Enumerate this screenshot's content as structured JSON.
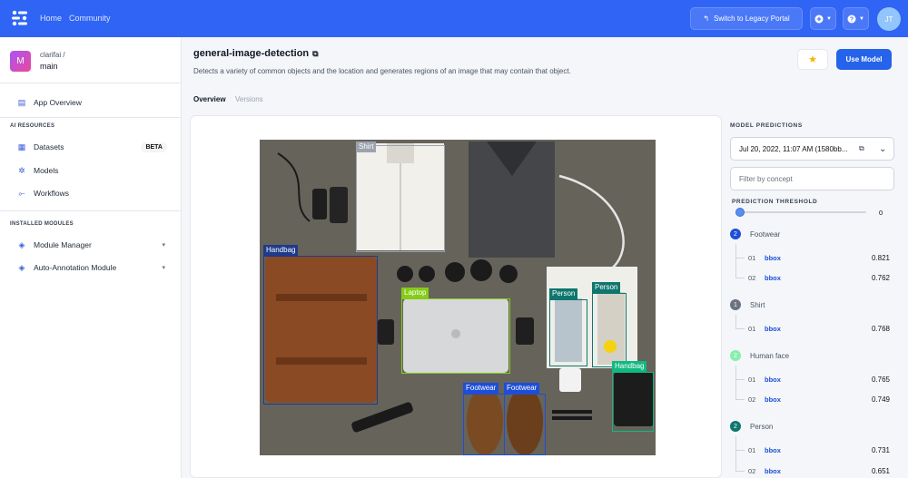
{
  "nav": {
    "links": [
      "Home",
      "Community"
    ],
    "legacy_button": "Switch to Legacy Portal",
    "user_initials": "JT",
    "add_icon": "plus-circle-icon",
    "help_icon": "question-circle-icon"
  },
  "sidebar": {
    "org": "clarifai /",
    "app_name": "main",
    "app_initial": "M",
    "overview_label": "App Overview",
    "ai_resources_heading": "AI RESOURCES",
    "resources": [
      {
        "label": "Datasets",
        "icon": "datasets-icon",
        "badge": "BETA"
      },
      {
        "label": "Models",
        "icon": "models-icon"
      },
      {
        "label": "Workflows",
        "icon": "workflows-icon"
      }
    ],
    "installed_modules_heading": "INSTALLED MODULES",
    "modules": [
      {
        "label": "Module Manager",
        "icon": "module-manager-icon"
      },
      {
        "label": "Auto-Annotation Module",
        "icon": "auto-annotation-icon"
      }
    ]
  },
  "header": {
    "title": "general-image-detection",
    "description": "Detects a variety of common objects and the location and generates regions of an image that may contain that object.",
    "use_model_label": "Use Model",
    "star_icon": "star-icon"
  },
  "tabs": {
    "overview": "Overview",
    "versions": "Versions"
  },
  "image": {
    "detections": [
      {
        "label": "Shirt",
        "color": "#9ca3af"
      },
      {
        "label": "Handbag",
        "color": "#1e3a8a"
      },
      {
        "label": "Laptop",
        "color": "#84cc16"
      },
      {
        "label": "Person",
        "color": "#0f766e"
      },
      {
        "label": "Person",
        "color": "#0f766e"
      },
      {
        "label": "Handbag",
        "color": "#10b981"
      },
      {
        "label": "Footwear",
        "color": "#1d4ed8"
      },
      {
        "label": "Footwear",
        "color": "#1d4ed8"
      }
    ]
  },
  "predictions": {
    "heading": "MODEL PREDICTIONS",
    "version": "Jul 20, 2022, 11:07 AM (1580bb...",
    "filter_placeholder": "Filter by concept",
    "threshold_label": "PREDICTION THRESHOLD",
    "threshold_value": "0",
    "threshold_fraction": 0,
    "concepts": [
      {
        "count": "2",
        "name": "Footwear",
        "color": "#1d4ed8",
        "rows": [
          {
            "idx": "01",
            "type": "bbox",
            "value": "0.821"
          },
          {
            "idx": "02",
            "type": "bbox",
            "value": "0.762"
          }
        ]
      },
      {
        "count": "1",
        "name": "Shirt",
        "color": "#6b7280",
        "rows": [
          {
            "idx": "01",
            "type": "bbox",
            "value": "0.768"
          }
        ]
      },
      {
        "count": "2",
        "name": "Human face",
        "color": "#86efac",
        "rows": [
          {
            "idx": "01",
            "type": "bbox",
            "value": "0.765"
          },
          {
            "idx": "02",
            "type": "bbox",
            "value": "0.749"
          }
        ]
      },
      {
        "count": "2",
        "name": "Person",
        "color": "#0f766e",
        "rows": [
          {
            "idx": "01",
            "type": "bbox",
            "value": "0.731"
          },
          {
            "idx": "02",
            "type": "bbox",
            "value": "0.651"
          }
        ]
      }
    ]
  }
}
